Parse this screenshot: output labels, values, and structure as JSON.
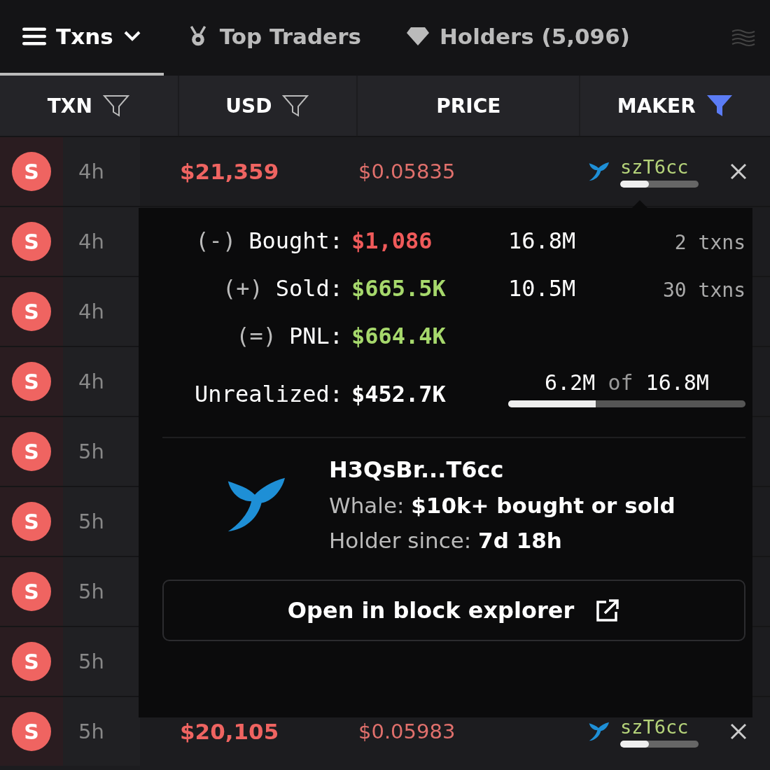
{
  "tabs": [
    {
      "label": "Txns",
      "dropdown": true,
      "selected": true
    },
    {
      "label": "Top Traders",
      "dropdown": false,
      "selected": false
    },
    {
      "label": "Holders (5,096)",
      "dropdown": false,
      "selected": false
    }
  ],
  "columns": [
    {
      "label": "TXN",
      "filter": true,
      "active": false
    },
    {
      "label": "USD",
      "filter": true,
      "active": false
    },
    {
      "label": "PRICE",
      "filter": false
    },
    {
      "label": "MAKER",
      "filter": true,
      "active": true
    }
  ],
  "rows": [
    {
      "side": "S",
      "age": "4h",
      "usd": "$21,359",
      "price": "$0.05835",
      "maker": "szT6cc",
      "level": 0.37
    },
    {
      "side": "S",
      "age": "4h"
    },
    {
      "side": "S",
      "age": "4h"
    },
    {
      "side": "S",
      "age": "4h"
    },
    {
      "side": "S",
      "age": "5h"
    },
    {
      "side": "S",
      "age": "5h"
    },
    {
      "side": "S",
      "age": "5h"
    },
    {
      "side": "S",
      "age": "5h"
    },
    {
      "side": "S",
      "age": "5h",
      "usd": "$20,105",
      "price": "$0.05983",
      "maker": "szT6cc",
      "level": 0.37
    }
  ],
  "popover": {
    "stats": [
      {
        "sign": "(-)",
        "label": "Bought:",
        "value": "$1,086",
        "kind": "loss",
        "amount": "16.8M",
        "txns": "2 txns"
      },
      {
        "sign": "(+)",
        "label": "Sold:",
        "value": "$665.5K",
        "kind": "profit",
        "amount": "10.5M",
        "txns": "30 txns"
      },
      {
        "sign": "(=)",
        "label": "PNL:",
        "value": "$664.4K",
        "kind": "profit"
      },
      {
        "label": "Unrealized:",
        "value": "$452.7K",
        "kind": "neutral",
        "held": "6.2M",
        "of": "of",
        "total": "16.8M",
        "level": 0.37
      }
    ],
    "address": "H3QsBr...T6cc",
    "lines": [
      "Whale: **$10k+ bought or sold**",
      "Holder since: **7d 18h**"
    ],
    "button": "Open in block explorer"
  }
}
